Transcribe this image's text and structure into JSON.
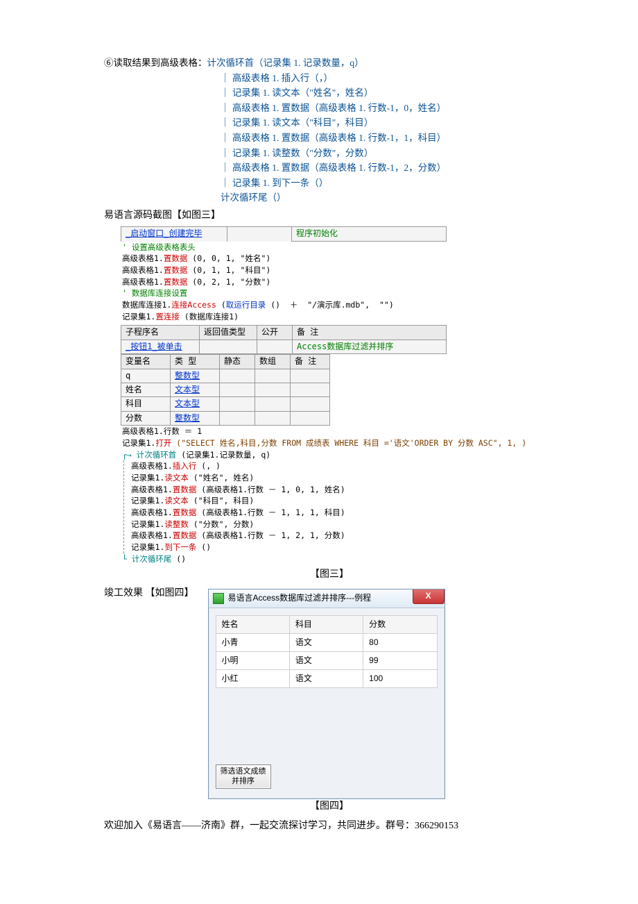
{
  "intro": {
    "step6_label": "⑥读取结果到高级表格：",
    "lines": [
      "计次循环首（记录集 1. 记录数量，q）",
      "｜ 高级表格 1. 插入行（，）",
      "｜ 记录集 1. 读文本（\"姓名\"，姓名）",
      "｜ 高级表格 1. 置数据（高级表格 1. 行数-1，0，姓名）",
      "｜ 记录集 1. 读文本（\"科目\"，科目）",
      "｜ 高级表格 1. 置数据（高级表格 1. 行数-1，1，科目）",
      "｜ 记录集 1. 读整数（\"分数\"，分数）",
      "｜ 高级表格 1. 置数据（高级表格 1. 行数-1，2，分数）",
      "｜ 记录集 1. 到下一条（）",
      "计次循环尾（）"
    ]
  },
  "fig3_heading": "易语言源码截图【如图三】",
  "ide": {
    "top_row": {
      "c1": "_启动窗口_创建完毕",
      "c2": "",
      "c3": "程序初始化"
    },
    "comment1": "' 设置高级表格表头",
    "setheaders": [
      {
        "pre": "高级表格1.",
        "red": "置数据",
        "tail": " (0, 0, 1, \"姓名\")"
      },
      {
        "pre": "高级表格1.",
        "red": "置数据",
        "tail": " (0, 1, 1, \"科目\")"
      },
      {
        "pre": "高级表格1.",
        "red": "置数据",
        "tail": " (0, 2, 1, \"分数\")"
      }
    ],
    "comment2": "' 数据库连接设置",
    "conn": {
      "pre": "数据库连接1.",
      "red": "连接Access",
      "tail": " (",
      "blue": "取运行目录",
      "tail2": " ()  ＋  \"/演示库.mdb\",  \"\")"
    },
    "conn2": {
      "pre": "记录集1.",
      "red": "置连接",
      "tail": " (数据库连接1)"
    },
    "sub_header": {
      "h1": "子程序名",
      "h2": "返回值类型",
      "h3": "公开",
      "h4": "备 注"
    },
    "sub_row": {
      "c1": "_按钮1_被单击",
      "c2": "",
      "c3": "",
      "c4": "Access数据库过滤并排序"
    },
    "var_header": {
      "h1": "变量名",
      "h2": "类 型",
      "h3": "静态",
      "h4": "数组",
      "h5": "备 注"
    },
    "vars": [
      {
        "n": "q",
        "t": "整数型"
      },
      {
        "n": "姓名",
        "t": "文本型"
      },
      {
        "n": "科目",
        "t": "文本型"
      },
      {
        "n": "分数",
        "t": "整数型"
      }
    ],
    "body": {
      "l1": "高级表格1.行数 ＝ 1",
      "l2": {
        "pre": "记录集1.",
        "red": "打开",
        "tail": " (\"SELECT 姓名,科目,分数 FROM 成绩表 WHERE 科目 ='语文'ORDER BY 分数 ASC\", 1, )"
      },
      "loop_head": {
        "arrow": "→",
        "teal": "计次循环首",
        "tail": " (记录集1.记录数量, q)"
      },
      "inner": [
        {
          "pre": "高级表格1.",
          "red": "插入行",
          "tail": " (, )"
        },
        {
          "pre": "记录集1.",
          "red": "读文本",
          "tail": " (\"姓名\", 姓名)"
        },
        {
          "pre": "高级表格1.",
          "red": "置数据",
          "tail": " (高级表格1.行数 － 1, 0, 1, 姓名)"
        },
        {
          "pre": "记录集1.",
          "red": "读文本",
          "tail": " (\"科目\", 科目)"
        },
        {
          "pre": "高级表格1.",
          "red": "置数据",
          "tail": " (高级表格1.行数 － 1, 1, 1, 科目)"
        },
        {
          "pre": "记录集1.",
          "red": "读整数",
          "tail": " (\"分数\", 分数)"
        },
        {
          "pre": "高级表格1.",
          "red": "置数据",
          "tail": " (高级表格1.行数 － 1, 2, 1, 分数)"
        },
        {
          "pre": "记录集1.",
          "red": "到下一条",
          "tail": " ()"
        }
      ],
      "loop_tail": {
        "teal": "计次循环尾",
        "tail": " ()"
      }
    }
  },
  "fig3_caption": "【图三】",
  "fig4_heading": "竣工效果 【如图四】",
  "app": {
    "title": "易语言Access数据库过滤并排序---例程",
    "close": "X",
    "headers": [
      "姓名",
      "科目",
      "分数"
    ],
    "rows": [
      [
        "小青",
        "语文",
        "80"
      ],
      [
        "小明",
        "语文",
        "99"
      ],
      [
        "小红",
        "语文",
        "100"
      ]
    ],
    "button": "筛选语文成绩并排序"
  },
  "fig4_caption": "【图四】",
  "footer": "欢迎加入《易语言——济南》群，一起交流探讨学习，共同进步。群号：366290153"
}
